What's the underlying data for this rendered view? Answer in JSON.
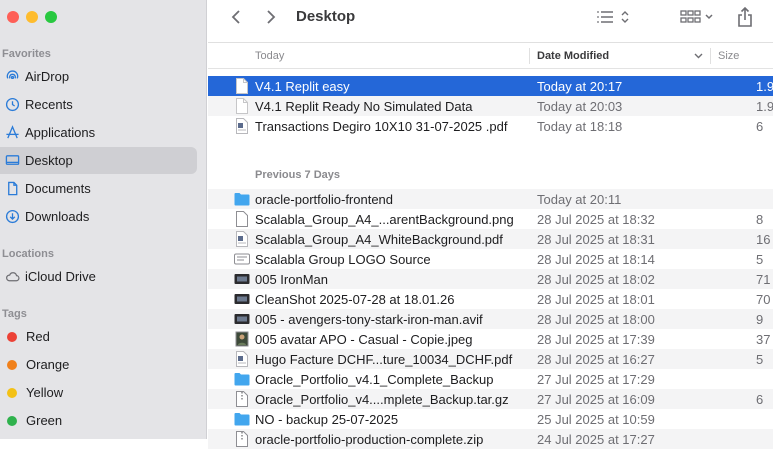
{
  "window": {
    "title": "Desktop"
  },
  "sidebar": {
    "favorites_label": "Favorites",
    "favorites": [
      {
        "label": "AirDrop",
        "icon": "airdrop-icon"
      },
      {
        "label": "Recents",
        "icon": "clock-icon"
      },
      {
        "label": "Applications",
        "icon": "applications-icon"
      },
      {
        "label": "Desktop",
        "icon": "desktop-icon",
        "active": true
      },
      {
        "label": "Documents",
        "icon": "document-icon"
      },
      {
        "label": "Downloads",
        "icon": "download-icon"
      }
    ],
    "locations_label": "Locations",
    "locations": [
      {
        "label": "iCloud Drive",
        "icon": "cloud-icon"
      }
    ],
    "tags_label": "Tags",
    "tags": [
      {
        "label": "Red",
        "color": "#ec4136"
      },
      {
        "label": "Orange",
        "color": "#f0801b"
      },
      {
        "label": "Yellow",
        "color": "#f3c116"
      },
      {
        "label": "Green",
        "color": "#2fb24d"
      }
    ]
  },
  "columns": {
    "name": "Today",
    "date": "Date Modified",
    "size": "Size"
  },
  "groups": {
    "today_label": "Today",
    "week_label": "Previous 7 Days"
  },
  "files_today": [
    {
      "name": "V4.1 Replit easy",
      "date": "Today at 20:17",
      "size": "1.9",
      "icon": "text-file-icon",
      "selected": true
    },
    {
      "name": "V4.1 Replit Ready No Simulated Data",
      "date": "Today at 20:03",
      "size": "1.9",
      "icon": "blank-file-icon"
    },
    {
      "name": "Transactions Degiro 10X10 31-07-2025 .pdf",
      "date": "Today at 18:18",
      "size": "6",
      "icon": "pdf-file-icon"
    }
  ],
  "files_week": [
    {
      "name": "oracle-portfolio-frontend",
      "date": "Today at 20:11",
      "size": "",
      "icon": "folder-icon"
    },
    {
      "name": "Scalabla_Group_A4_...arentBackground.png",
      "date": "28 Jul 2025 at 18:32",
      "size": "8",
      "icon": "image-file-icon"
    },
    {
      "name": "Scalabla_Group_A4_WhiteBackground.pdf",
      "date": "28 Jul 2025 at 18:31",
      "size": "16",
      "icon": "pdf-file-icon"
    },
    {
      "name": "Scalabla Group LOGO Source",
      "date": "28 Jul 2025 at 18:14",
      "size": "5",
      "icon": "design-file-icon"
    },
    {
      "name": "005 IronMan",
      "date": "28 Jul 2025 at 18:02",
      "size": "71",
      "icon": "video-file-icon"
    },
    {
      "name": "CleanShot 2025-07-28 at 18.01.26",
      "date": "28 Jul 2025 at 18:01",
      "size": "70",
      "icon": "video-file-icon"
    },
    {
      "name": "005 - avengers-tony-stark-iron-man.avif",
      "date": "28 Jul 2025 at 18:00",
      "size": "9",
      "icon": "video-file-icon"
    },
    {
      "name": "005 avatar APO - Casual - Copie.jpeg",
      "date": "28 Jul 2025 at 17:39",
      "size": "37",
      "icon": "photo-file-icon"
    },
    {
      "name": "Hugo Facture DCHF...ture_10034_DCHF.pdf",
      "date": "28 Jul 2025 at 16:27",
      "size": "5",
      "icon": "pdf-file-icon"
    },
    {
      "name": "Oracle_Portfolio_v4.1_Complete_Backup",
      "date": "27 Jul 2025 at 17:29",
      "size": "",
      "icon": "folder-icon"
    },
    {
      "name": "Oracle_Portfolio_v4....mplete_Backup.tar.gz",
      "date": "27 Jul 2025 at 16:09",
      "size": "6",
      "icon": "archive-file-icon"
    },
    {
      "name": "NO - backup 25-07-2025",
      "date": "25 Jul 2025 at 10:59",
      "size": "",
      "icon": "folder-icon"
    },
    {
      "name": "oracle-portfolio-production-complete.zip",
      "date": "24 Jul 2025 at 17:27",
      "size": "",
      "icon": "archive-file-icon"
    }
  ]
}
